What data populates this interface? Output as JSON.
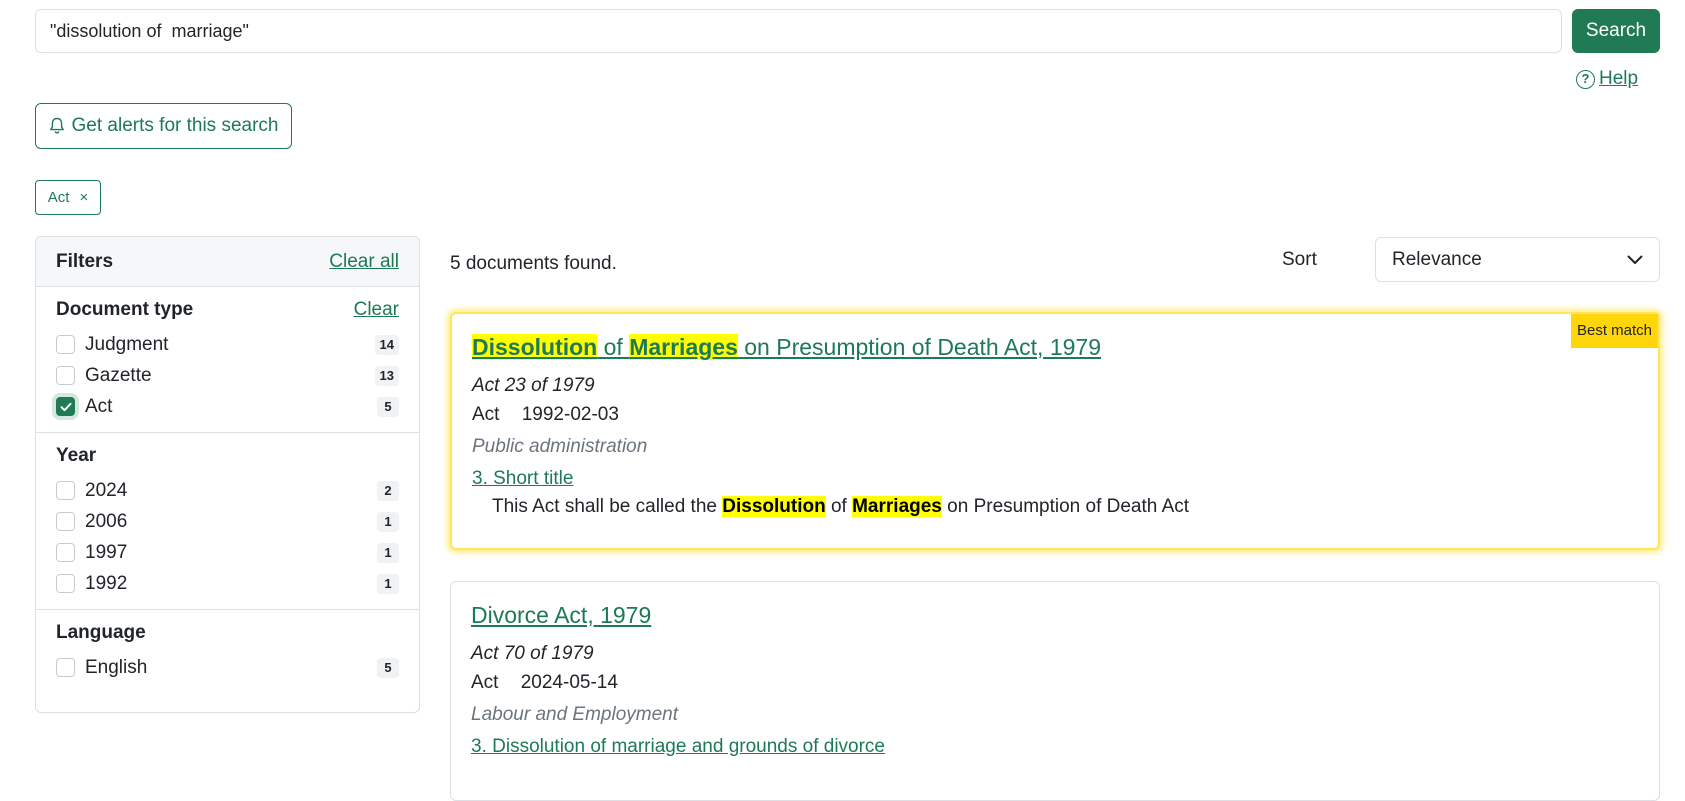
{
  "search": {
    "value": "\"dissolution of  marriage\"",
    "button_label": "Search"
  },
  "help": {
    "label": "Help"
  },
  "alerts": {
    "label": "Get alerts for this search"
  },
  "active_filter": {
    "label": "Act",
    "remove": "×"
  },
  "filters": {
    "title": "Filters",
    "clear_all": "Clear all",
    "document_type": {
      "title": "Document type",
      "clear": "Clear",
      "options": [
        {
          "label": "Judgment",
          "count": "14",
          "checked": false
        },
        {
          "label": "Gazette",
          "count": "13",
          "checked": false
        },
        {
          "label": "Act",
          "count": "5",
          "checked": true
        }
      ]
    },
    "year": {
      "title": "Year",
      "options": [
        {
          "label": "2024",
          "count": "2"
        },
        {
          "label": "2006",
          "count": "1"
        },
        {
          "label": "1997",
          "count": "1"
        },
        {
          "label": "1992",
          "count": "1"
        }
      ]
    },
    "language": {
      "title": "Language",
      "options": [
        {
          "label": "English",
          "count": "5"
        }
      ]
    }
  },
  "results": {
    "count_text": "5 documents found.",
    "sort_label": "Sort",
    "sort_value": "Relevance",
    "items": [
      {
        "badge": "Best match",
        "title_parts": [
          "Dissolution",
          " of ",
          "Marriages",
          " on Presumption of Death Act, 1979"
        ],
        "citation": "Act 23 of 1979",
        "doc_type": "Act",
        "date": "1992-02-03",
        "category": "Public administration",
        "section": "3. Short title",
        "snippet_parts": [
          "This Act shall be called the ",
          "Dissolution",
          " of ",
          "Marriages",
          " on Presumption of Death Act"
        ]
      },
      {
        "title": "Divorce Act, 1979",
        "citation": "Act 70 of 1979",
        "doc_type": "Act",
        "date": "2024-05-14",
        "category": "Labour and Employment",
        "section": "3. Dissolution of marriage and grounds of divorce"
      }
    ]
  },
  "colors": {
    "accent": "#1f7a55",
    "highlight": "#ffff00",
    "badge": "#ffd60a"
  }
}
